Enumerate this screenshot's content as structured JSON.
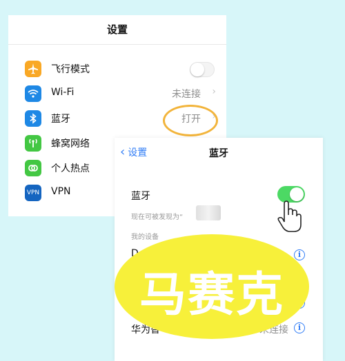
{
  "settings": {
    "title": "设置",
    "items": [
      {
        "label": "飞行模式",
        "icon": "airplane-icon",
        "color": "#f9a825",
        "value": "",
        "control": "toggle-off"
      },
      {
        "label": "Wi-Fi",
        "icon": "wifi-icon",
        "color": "#1e88e5",
        "value": "未连接",
        "control": "chevron"
      },
      {
        "label": "蓝牙",
        "icon": "bluetooth-icon",
        "color": "#1e88e5",
        "value": "打开",
        "control": "chevron"
      },
      {
        "label": "蜂窝网络",
        "icon": "cellular-icon",
        "color": "#43c743",
        "value": "",
        "control": "none"
      },
      {
        "label": "个人热点",
        "icon": "hotspot-icon",
        "color": "#43c743",
        "value": "",
        "control": "none"
      },
      {
        "label": "VPN",
        "icon": "vpn-icon",
        "color": "#1565c0",
        "value": "",
        "control": "none",
        "icon_text": "VPN"
      }
    ]
  },
  "bluetooth": {
    "back_label": "设置",
    "title": "蓝牙",
    "toggle_label": "蓝牙",
    "toggle_on": true,
    "discoverable_text": "现在可被发现为“",
    "my_devices_header": "我的设备",
    "devices": [
      {
        "name": "D",
        "status": ""
      },
      {
        "name": "华为智",
        "status": "未连接"
      }
    ]
  },
  "overlay": {
    "stamp_text": "马赛克",
    "stamp_color": "#f7f03a"
  }
}
